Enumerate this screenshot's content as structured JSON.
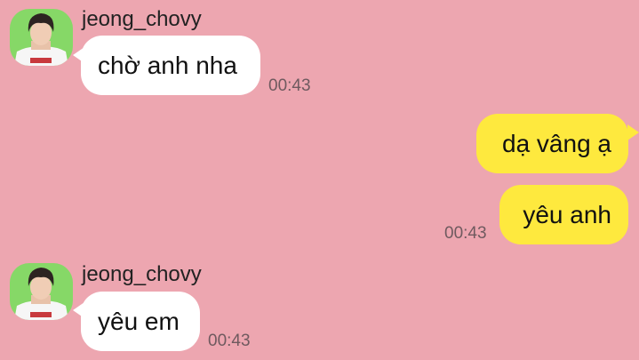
{
  "theme": {
    "background": "#eda6b0",
    "incoming_bubble": "#ffffff",
    "outgoing_bubble": "#fee93e"
  },
  "messages": [
    {
      "direction": "incoming",
      "sender": "jeong_chovy",
      "avatar_icon": "profile-photo",
      "text": "chờ anh nha",
      "time": "00:43"
    },
    {
      "direction": "outgoing",
      "text": "dạ vâng ạ"
    },
    {
      "direction": "outgoing",
      "text": "yêu anh",
      "time": "00:43"
    },
    {
      "direction": "incoming",
      "sender": "jeong_chovy",
      "avatar_icon": "profile-photo",
      "text": "yêu em",
      "time": "00:43"
    }
  ]
}
